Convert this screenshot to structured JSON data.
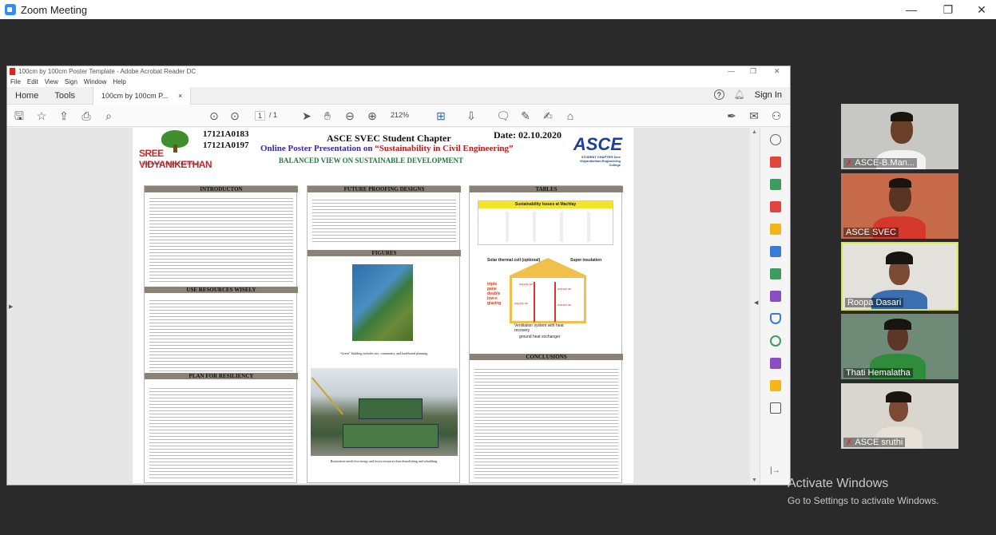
{
  "zoom": {
    "title": "Zoom Meeting",
    "minimize": "—",
    "restore": "❐",
    "close": "✕"
  },
  "acrobat": {
    "title": "100cm by 100cm Poster Template - Adobe Acrobat Reader DC",
    "menu": [
      "File",
      "Edit",
      "View",
      "Sign",
      "Window",
      "Help"
    ],
    "tabs": {
      "home": "Home",
      "tools": "Tools",
      "doc": "100cm by 100cm P...",
      "doc_close": "×"
    },
    "sign_in": "Sign In",
    "page_current": "1",
    "page_total": "/ 1",
    "zoom_level": "212%"
  },
  "poster": {
    "roll1": "17121A0183",
    "roll2": "17121A0197",
    "chapter": "ASCE SVEC Student Chapter",
    "date": "Date: 02.10.2020",
    "online": "Online Poster Presentation on",
    "theme": "“Sustainability in Civil Engineering”",
    "balanced": "BALANCED VIEW ON SUSTAINABLE DEVELOPMENT",
    "logo_left": "SREE VIDYANIKETHAN",
    "logo_left_sub": "Engineering College (Autonomous)",
    "logo_right": "ASCE",
    "logo_right_sub": "STUDENT CHAPTER Sree Vidyanikethan Engineering College",
    "sections": {
      "introduction": "INTRODUCTON",
      "use_resources": "USE RESOURCES WISELY",
      "resiliency": "PLAN FOR RESILIENCY",
      "future": "FUTURE PROOFING DESIGNS",
      "figures": "FIGURES",
      "tables": "TABLES",
      "conclusions": "CONCLUSIONS"
    },
    "fig1_caption": "“Green” building includes site, community, and land-based planning.",
    "fig2_caption": "Restoration needs less energy and fewer resources than demolishing and rebuilding.",
    "table_title": "Sustainability Issues at Machlay",
    "diagram": {
      "solar": "Solar thermal coll (optional)",
      "super": "Super insulation",
      "glazing": "triple pane double low-e glazing",
      "supply1": "supply air",
      "extract1": "extract air",
      "supply2": "supply air",
      "extract2": "extract air",
      "vent": "Ventilation system with heat recovery",
      "ground": "ground heat exchanger"
    }
  },
  "participants": [
    {
      "name": "ASCE-B.Man...",
      "muted": true
    },
    {
      "name": "ASCE SVEC",
      "muted": false
    },
    {
      "name": "Roopa Dasari",
      "muted": false
    },
    {
      "name": "Thati Hemalatha",
      "muted": false
    },
    {
      "name": "ASCE sruthi",
      "muted": true
    }
  ],
  "watermark": {
    "title": "Activate Windows",
    "sub": "Go to Settings to activate Windows."
  },
  "colors": {
    "zoom_bg": "#2a2a2a",
    "active_speaker": "#d7e84e",
    "asce_blue": "#1b3f9e",
    "poster_red": "#b01e1e"
  }
}
